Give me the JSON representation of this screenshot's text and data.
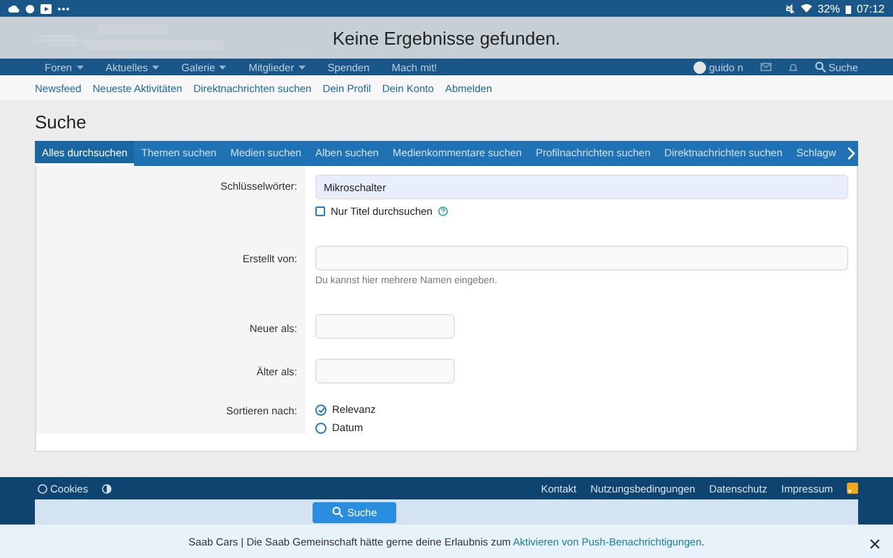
{
  "status_bar": {
    "battery": "32%",
    "time": "07:12"
  },
  "toast": {
    "message": "Keine Ergebnisse gefunden."
  },
  "nav": {
    "items": [
      {
        "label": "Foren",
        "dropdown": true
      },
      {
        "label": "Aktuelles",
        "dropdown": true
      },
      {
        "label": "Galerie",
        "dropdown": true
      },
      {
        "label": "Mitglieder",
        "dropdown": true
      },
      {
        "label": "Spenden",
        "dropdown": false
      },
      {
        "label": "Mach mit!",
        "dropdown": false
      }
    ],
    "user": "guido n",
    "search": "Suche"
  },
  "subnav": [
    "Newsfeed",
    "Neueste Aktivitäten",
    "Direktnachrichten suchen",
    "Dein Profil",
    "Dein Konto",
    "Abmelden"
  ],
  "page_title": "Suche",
  "tabs": [
    {
      "label": "Alles durchsuchen",
      "selected": true
    },
    {
      "label": "Themen suchen",
      "selected": false
    },
    {
      "label": "Medien suchen",
      "selected": false
    },
    {
      "label": "Alben suchen",
      "selected": false
    },
    {
      "label": "Medienkommentare suchen",
      "selected": false
    },
    {
      "label": "Profilnachrichten suchen",
      "selected": false
    },
    {
      "label": "Direktnachrichten suchen",
      "selected": false
    },
    {
      "label": "Schlagw",
      "selected": false
    }
  ],
  "form": {
    "keywords": {
      "label": "Schlüsselwörter:",
      "value": "Mikroschalter"
    },
    "title_only": {
      "label": "Nur Titel durchsuchen",
      "checked": false
    },
    "created_by": {
      "label": "Erstellt von:",
      "hint": "Du kannst hier mehrere Namen eingeben."
    },
    "newer": {
      "label": "Neuer als:"
    },
    "older": {
      "label": "Älter als:"
    },
    "sort": {
      "label": "Sortieren nach:",
      "options": [
        {
          "label": "Relevanz",
          "selected": true
        },
        {
          "label": "Datum",
          "selected": false
        }
      ]
    }
  },
  "footer": {
    "cookies": "Cookies",
    "links": [
      "Kontakt",
      "Nutzungsbedingungen",
      "Datenschutz",
      "Impressum"
    ]
  },
  "submit": "Suche",
  "push_banner": {
    "text": "Saab Cars | Die Saab Gemeinschaft hätte gerne deine Erlaubnis zum ",
    "link": "Aktivieren von Push-Benachrichtigungen",
    "end": "."
  }
}
